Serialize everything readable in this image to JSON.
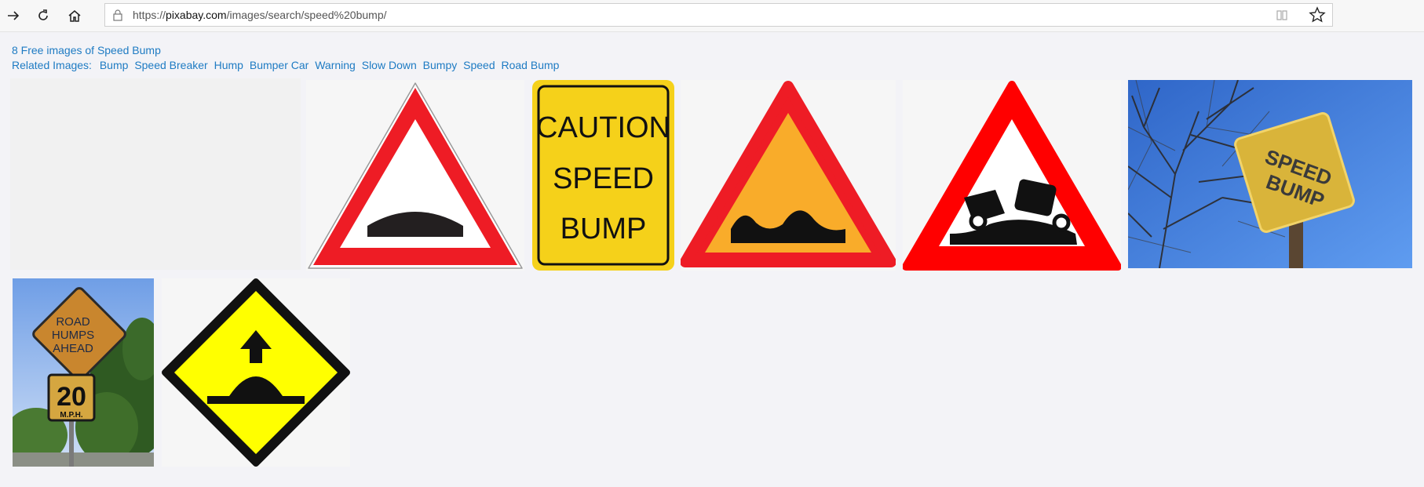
{
  "browser": {
    "url_prefix": "https://",
    "url_host": "pixabay.com",
    "url_path": "/images/search/speed%20bump/",
    "icons": {
      "forward": "arrow-right-icon",
      "reload": "reload-icon",
      "home": "home-icon",
      "lock": "lock-icon",
      "reader": "reading-view-icon",
      "favorite": "star-icon"
    }
  },
  "results": {
    "count_text": "8 Free images of Speed Bump",
    "related_label": "Related Images:",
    "related_tags": [
      "Bump",
      "Speed Breaker",
      "Hump",
      "Bumper Car",
      "Warning",
      "Slow Down",
      "Bumpy",
      "Speed",
      "Road Bump"
    ]
  },
  "signs": {
    "caution_line1": "CAUTION",
    "caution_line2": "SPEED",
    "caution_line3": "BUMP",
    "speed_bump_line1": "SPEED",
    "speed_bump_line2": "BUMP",
    "road_humps_line1": "ROAD",
    "road_humps_line2": "HUMPS",
    "road_humps_line3": "AHEAD",
    "speed_limit_value": "20",
    "speed_limit_unit": "M.P.H."
  },
  "colors": {
    "link": "#1e7bc3",
    "sign_red": "#ee1c25",
    "sign_yellow": "#f5d11a",
    "sign_orange": "#f9ac2a",
    "diamond_yellow": "#ffff00",
    "sky_blue": "#3a78d8"
  }
}
